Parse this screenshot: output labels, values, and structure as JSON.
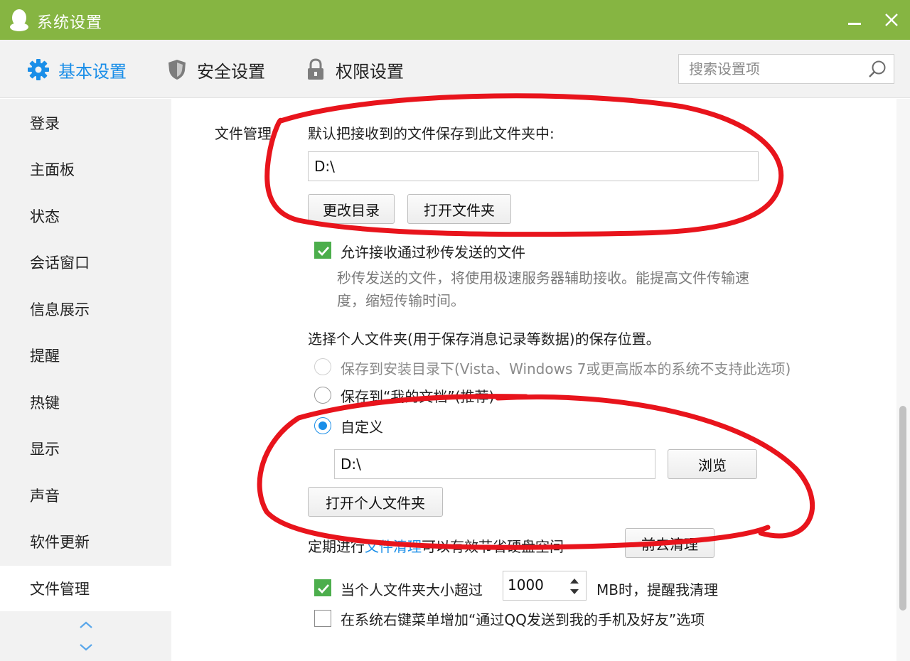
{
  "window": {
    "title": "系统设置",
    "minimize_label": "—",
    "close_label": "✕"
  },
  "tabs": [
    {
      "label": "基本设置",
      "icon": "gear-icon",
      "active": true
    },
    {
      "label": "安全设置",
      "icon": "shield-icon"
    },
    {
      "label": "权限设置",
      "icon": "lock-icon"
    }
  ],
  "search": {
    "placeholder": "搜索设置项"
  },
  "sidebar": {
    "items": [
      {
        "label": "登录"
      },
      {
        "label": "主面板"
      },
      {
        "label": "状态"
      },
      {
        "label": "会话窗口"
      },
      {
        "label": "信息展示"
      },
      {
        "label": "提醒"
      },
      {
        "label": "热键"
      },
      {
        "label": "显示"
      },
      {
        "label": "声音"
      },
      {
        "label": "软件更新"
      },
      {
        "label": "文件管理",
        "active": true
      }
    ]
  },
  "file_mgmt": {
    "section_label": "文件管理",
    "default_save_desc": "默认把接收到的文件保存到此文件夹中:",
    "default_path": "D:\\",
    "change_dir_button": "更改目录",
    "open_folder_button": "打开文件夹",
    "allow_flash_label": "允许接收通过秒传发送的文件",
    "allow_flash_desc_line1": "秒传发送的文件，将使用极速服务器辅助接收。能提高文件传输速",
    "allow_flash_desc_line2": "度，缩短传输时间。",
    "personal_folder_title": "选择个人文件夹(用于保存消息记录等数据)的保存位置。",
    "option_install_dir": "保存到安装目录下(Vista、Windows 7或更高版本的系统不支持此选项)",
    "option_my_docs": "保存到“我的文档”(推荐)",
    "option_custom": "自定义",
    "custom_path": "D:\\",
    "browse_button": "浏览",
    "open_personal_button": "打开个人文件夹",
    "cleanup_prefix": "定期进行",
    "cleanup_link": "文件清理",
    "cleanup_suffix": "可以有效节省硬盘空间",
    "cleanup_button": "前去清理",
    "size_warn_label": "当个人文件夹大小超过",
    "size_value": "1000",
    "size_warn_suffix": "MB时，提醒我清理",
    "context_menu_label": "在系统右键菜单增加“通过QQ发送到我的手机及好友”选项"
  },
  "colors": {
    "titlebar": "#86b542",
    "accent": "#1a8ee8",
    "check": "#4cae4c",
    "annotation": "#e8141c"
  }
}
